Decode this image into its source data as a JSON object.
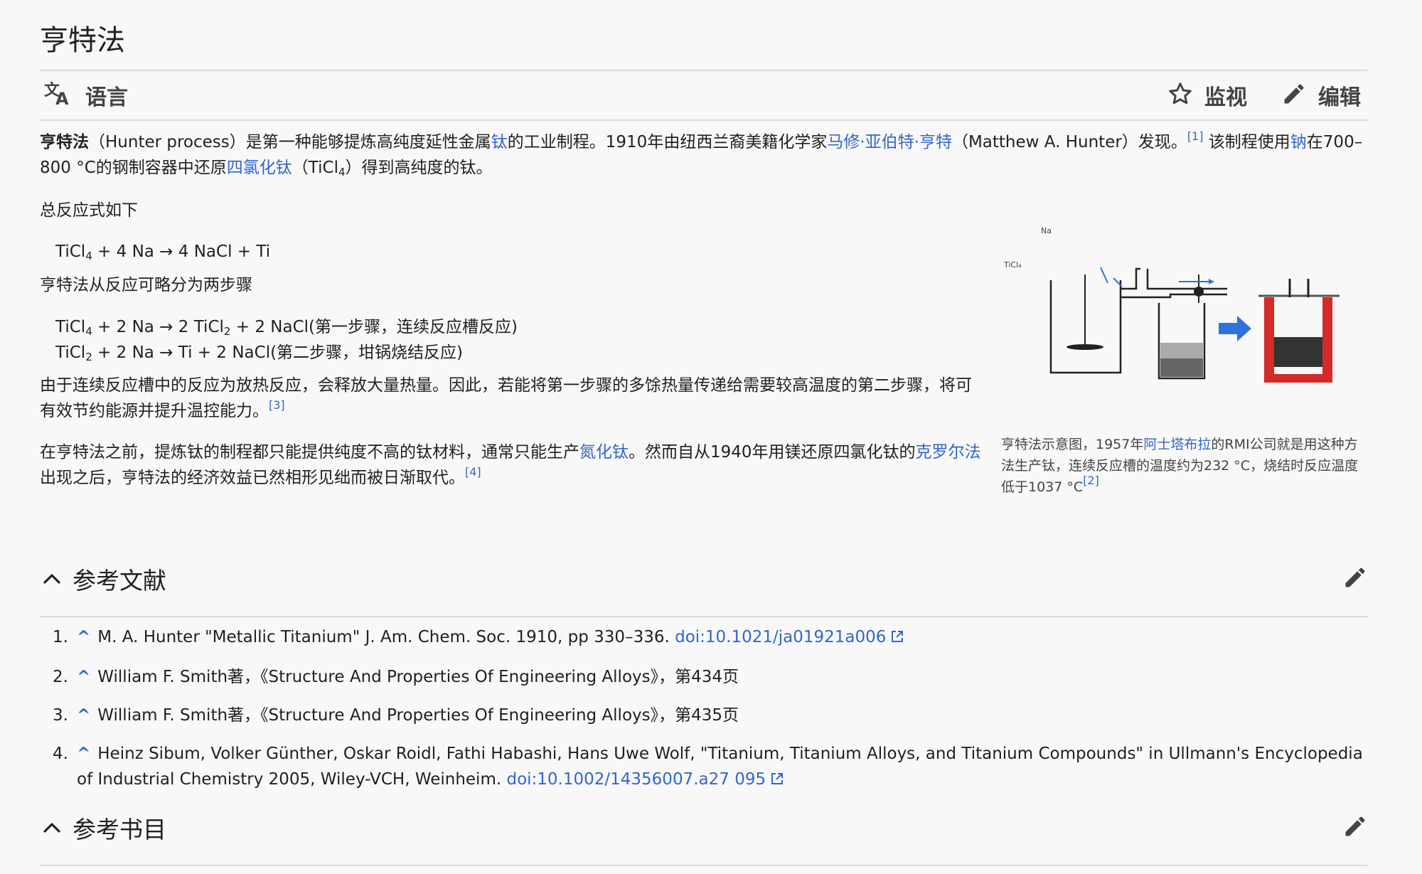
{
  "title": "亨特法",
  "toolbar": {
    "language_label": "语言",
    "watch_label": "监视",
    "edit_label": "编辑"
  },
  "intro": {
    "term": "亨特法",
    "part1": "（Hunter process）是第一种能够提炼高纯度延性金属",
    "link_ti": "钛",
    "part2": "的工业制程。1910年由纽西兰裔美籍化学家",
    "link_hunter": "马修·亚伯特·亨特",
    "part3": "（Matthew A. Hunter）发现。",
    "ref1": "[1]",
    "part4": " 该制程使用",
    "link_na": "钠",
    "part5": "在700–800 °C的钢制容器中还原",
    "link_ticl4": "四氯化钛",
    "part6a": "（TiCl",
    "part6sub": "4",
    "part6b": "）得到高纯度的钛。"
  },
  "overall": {
    "label": "总反应式如下",
    "eq_a": "TiCl",
    "eq_sub": "4",
    "eq_b": " + 4 Na → 4 NaCl + Ti"
  },
  "steps": {
    "label": "亨特法从反应可略分为两步骤",
    "s1_a": "TiCl",
    "s1_sub1": "4",
    "s1_b": " + 2 Na → 2 TiCl",
    "s1_sub2": "2",
    "s1_c": " + 2 NaCl(第一步骤，连续反应槽反应)",
    "s2_a": "TiCl",
    "s2_sub": "2",
    "s2_b": " + 2 Na → Ti + 2 NaCl(第二步骤，坩锅烧结反应)"
  },
  "heat": {
    "text": "由于连续反应槽中的反应为放热反应，会释放大量热量。因此，若能将第一步骤的多馀热量传递给需要较高温度的第二步骤，将可有效节约能源并提升温控能力。",
    "ref": "[3]"
  },
  "history": {
    "part1": "在亨特法之前，提炼钛的制程都只能提供纯度不高的钛材料，通常只能生产",
    "link_tin": "氮化钛",
    "part2": "。然而自从1940年用镁还原四氯化钛的",
    "link_kroll": "克罗尔法",
    "part3": "出现之后，亨特法的经济效益已然相形见绌而被日渐取代。",
    "ref": "[4]"
  },
  "figure": {
    "label_na": "Na",
    "label_ticl4": "TiCl₄",
    "caption_part1": "亨特法示意图，1957年",
    "caption_link": "阿士塔布拉",
    "caption_part2": "的RMI公司就是用这种方法生产钛，连续反应槽的温度约为232 °C，烧结时反应温度低于1037 °C",
    "caption_ref": "[2]"
  },
  "references": {
    "title": "参考文献",
    "items": [
      {
        "num": "1.",
        "text": "M. A. Hunter \"Metallic Titanium\" J. Am. Chem. Soc. 1910, pp 330–336. ",
        "link": "doi:10.1021/ja01921a006"
      },
      {
        "num": "2.",
        "text": "William F. Smith著，《Structure And Properties Of Engineering Alloys》，第434页"
      },
      {
        "num": "3.",
        "text": "William F. Smith著，《Structure And Properties Of Engineering Alloys》，第435页"
      },
      {
        "num": "4.",
        "text": "Heinz Sibum, Volker Günther, Oskar Roidl, Fathi Habashi, Hans Uwe Wolf, \"Titanium, Titanium Alloys, and Titanium Compounds\" in Ullmann's Encyclopedia of Industrial Chemistry 2005, Wiley-VCH, Weinheim. ",
        "link": "doi:10.1002/14356007.a27 095"
      }
    ]
  },
  "bibliography": {
    "title": "参考书目"
  },
  "colors": {
    "link": "#3366cc",
    "text": "#202122",
    "diagram_red": "#d42a2a",
    "diagram_blue": "#2e73d9"
  },
  "icons": [
    "translate-icon",
    "star-icon",
    "pencil-icon",
    "chevron-up-icon",
    "external-link-icon",
    "arrow-right-icon"
  ]
}
